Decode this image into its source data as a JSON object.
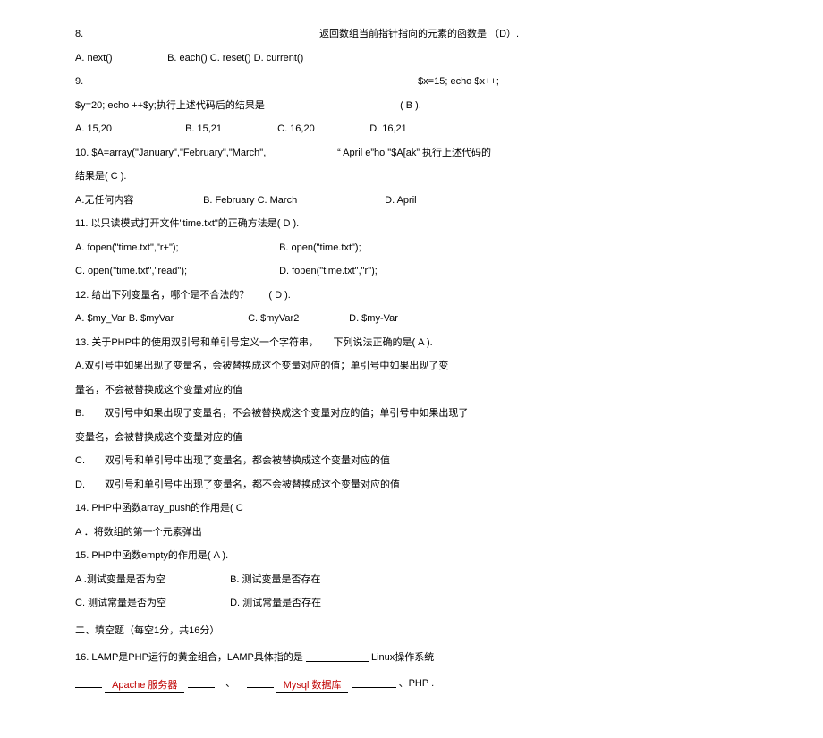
{
  "q8": {
    "num": "8.",
    "stem": "返回数组当前指针指向的元素的函数是  （D）.",
    "optA": "A. next()",
    "optB": "B. each() C. reset() D. current()"
  },
  "q9": {
    "num": "9.",
    "right": "$x=15; echo $x++;",
    "stem2": "$y=20; echo ++$y;执行上述代码后的结果是",
    "ans": "( B ).",
    "optA": "A. 15,20",
    "optB": "B. 15,21",
    "optC": "C. 16,20",
    "optD": "D. 16,21"
  },
  "q10": {
    "row1a": "10.   $A=array(\"January\",\"February\",\"March\",",
    "row1b": "“ April e”ho \"$A[ak”  执行上述代码的",
    "row2": "结果是( C ).",
    "optA": "A.无任何内容",
    "optBC": "B. February C. March",
    "optD": "D. April"
  },
  "q11": {
    "stem": "11.   以只读模式打开文件\"time.txt\"的正确方法是( D ).",
    "optA": "A. fopen(\"time.txt\",\"r+\");",
    "optB": "B. open(\"time.txt\");",
    "optC": "C. open(\"time.txt\",\"read\");",
    "optD": "D. fopen(\"time.txt\",\"r\");"
  },
  "q12": {
    "stem": "12.   给出下列变量名，哪个是不合法的？　　( D ).",
    "optAB": "A. $my_Var B. $myVar",
    "optC": "C. $myVar2",
    "optD": "D. $my-Var"
  },
  "q13": {
    "stem": "13.   关于PHP中的使用双引号和单引号定义一个字符串，　　下列说法正确的是( A ).",
    "optA1": "A.双引号中如果出现了变量名，会被替换成这个变量对应的值；单引号中如果出现了变",
    "optA2": "量名，不会被替换成这个变量对应的值",
    "optB1": "B.　　双引号中如果出现了变量名，不会被替换成这个变量对应的值；单引号中如果出现了",
    "optB2": "变量名，会被替换成这个变量对应的值",
    "optC": "C.　　双引号和单引号中出现了变量名，都会被替换成这个变量对应的值",
    "optD": "D.　　双引号和单引号中出现了变量名，都不会被替换成这个变量对应的值"
  },
  "q14": {
    "stem": "14.   PHP中函数array_push的作用是( C",
    "optA": "A ．将数组的第一个元素弹出"
  },
  "q15": {
    "stem": "15.   PHP中函数empty的作用是( A ).",
    "optA": "A .测试变量是否为空",
    "optB": "B. 测试变量是否存在",
    "optC": "C. 测试常量是否为空",
    "optD": "D. 测试常量是否存在"
  },
  "section2": "二、填空题（每空1分，共16分）",
  "q16": {
    "p1": "16.   LAMP是PHP运行的黄金组合，LAMP具体指的是",
    "p2": "Linux操作系统",
    "a1": "Apache 服务器",
    "dot": "、",
    "a2": "Mysql 数据库",
    "tail": "、PHP ."
  }
}
